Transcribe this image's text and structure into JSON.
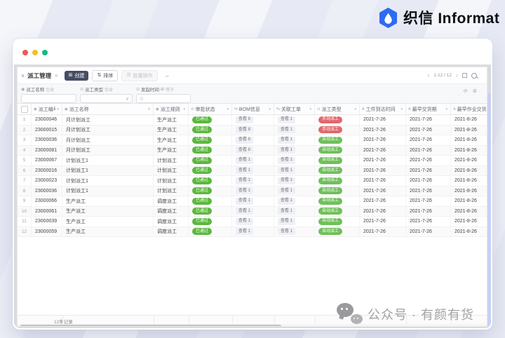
{
  "brand": {
    "name_cn": "织信",
    "name_en": "Informat"
  },
  "watermark": {
    "text": "公众号 · 有颜有货"
  },
  "colors": {
    "brand_blue": "#2e6bf2",
    "status_green": "#5cb83e",
    "type_green": "#6fc05a",
    "type_red": "#e0686d",
    "traffic_red": "#f5564e",
    "traffic_yellow": "#f7bd2c",
    "traffic_green": "#16b981"
  },
  "toolbar": {
    "collapse_glyph": "∨",
    "title": "派工管理",
    "share_glyph": "«",
    "create_label": "创建",
    "create_icon_glyph": "⊞",
    "sort_label": "排序",
    "sort_icon_glyph": "⇅",
    "batch_label": "批量操作",
    "batch_icon_glyph": "☰",
    "more_glyph": "–",
    "prev_glyph": "‹",
    "pagination": "1-12 / 12",
    "next_glyph": "›"
  },
  "filters": [
    {
      "glyph": "◉",
      "label": "派工名称",
      "op": "包含"
    },
    {
      "glyph": "⊙",
      "label": "派工类型",
      "op": "包含"
    },
    {
      "glyph": "⊙",
      "label": "发起时间",
      "extra_glyph": "⊞",
      "op": "等于"
    }
  ],
  "filterbar_icons": {
    "refresh_glyph": "⟳",
    "settings_glyph": "⚙"
  },
  "table": {
    "columns": [
      {
        "key": "code",
        "label": "派工编号",
        "icon_glyph": "◉",
        "icon_name": "text-field-icon"
      },
      {
        "key": "name",
        "label": "派工名称",
        "icon_glyph": "◉",
        "icon_name": "text-field-icon"
      },
      {
        "key": "rule",
        "label": "派工规则",
        "icon_glyph": "◉",
        "icon_name": "text-field-icon"
      },
      {
        "key": "status",
        "label": "审批状态",
        "icon_glyph": "⊙",
        "icon_name": "select-field-icon"
      },
      {
        "key": "bom",
        "label": "BOM信息",
        "icon_glyph": "%",
        "icon_name": "link-field-icon"
      },
      {
        "key": "order",
        "label": "关联工单",
        "icon_glyph": "%",
        "icon_name": "link-field-icon"
      },
      {
        "key": "type",
        "label": "派工类型",
        "icon_glyph": "⊙",
        "icon_name": "select-field-icon"
      },
      {
        "key": "arrive",
        "label": "工件到达时间",
        "icon_glyph": "A",
        "icon_name": "date-field-icon"
      },
      {
        "key": "due",
        "label": "最早交货期",
        "icon_glyph": "A",
        "icon_name": "date-field-icon"
      },
      {
        "key": "job_due",
        "label": "最早作业交货期",
        "icon_glyph": "A",
        "icon_name": "date-field-icon"
      }
    ],
    "rows": [
      {
        "num": 1,
        "code": "23000046",
        "name": "月计划派工",
        "rule": "生产派工",
        "status": "已通过",
        "bom": "查看 8",
        "order": "查看 1",
        "type": "手动派工",
        "type_style": "red",
        "arrive": "2021-7-26",
        "due": "2021-7-26",
        "job_due": "2021-8-26"
      },
      {
        "num": 2,
        "code": "23000015",
        "name": "月计划派工",
        "rule": "生产派工",
        "status": "已通过",
        "bom": "查看 8",
        "order": "查看 1",
        "type": "手动派工",
        "type_style": "red",
        "arrive": "2021-7-26",
        "due": "2021-7-26",
        "job_due": "2021-8-26"
      },
      {
        "num": 3,
        "code": "23000036",
        "name": "月计划派工",
        "rule": "生产派工",
        "status": "已通过",
        "bom": "查看 8",
        "order": "查看 1",
        "type": "自动派工",
        "type_style": "green",
        "arrive": "2021-7-26",
        "due": "2021-7-26",
        "job_due": "2021-8-26"
      },
      {
        "num": 4,
        "code": "23000081",
        "name": "月计划派工",
        "rule": "生产派工",
        "status": "已通过",
        "bom": "查看 8",
        "order": "查看 1",
        "type": "自动派工",
        "type_style": "green",
        "arrive": "2021-7-26",
        "due": "2021-7-26",
        "job_due": "2021-8-26"
      },
      {
        "num": 5,
        "code": "23000067",
        "name": "计划派工1",
        "rule": "计划派工",
        "status": "已通过",
        "bom": "查看 1",
        "order": "查看 1",
        "type": "自动派工",
        "type_style": "green",
        "arrive": "2021-7-26",
        "due": "2021-7-26",
        "job_due": "2021-8-26"
      },
      {
        "num": 6,
        "code": "23000016",
        "name": "计划派工1",
        "rule": "计划派工",
        "status": "已通过",
        "bom": "查看 1",
        "order": "查看 1",
        "type": "自动派工",
        "type_style": "green",
        "arrive": "2021-7-26",
        "due": "2021-7-26",
        "job_due": "2021-8-26"
      },
      {
        "num": 7,
        "code": "23000023",
        "name": "计划派工1",
        "rule": "计划派工",
        "status": "已通过",
        "bom": "查看 1",
        "order": "查看 1",
        "type": "自动派工",
        "type_style": "green",
        "arrive": "2021-7-26",
        "due": "2021-7-26",
        "job_due": "2021-8-26"
      },
      {
        "num": 8,
        "code": "23000036",
        "name": "计划派工1",
        "rule": "计划派工",
        "status": "已通过",
        "bom": "查看 1",
        "order": "查看 1",
        "type": "自动派工",
        "type_style": "green",
        "arrive": "2021-7-26",
        "due": "2021-7-26",
        "job_due": "2021-8-26"
      },
      {
        "num": 9,
        "code": "23000066",
        "name": "生产派工",
        "rule": "调度派工",
        "status": "已通过",
        "bom": "查看 1",
        "order": "查看 1",
        "type": "自动派工",
        "type_style": "green",
        "arrive": "2021-7-26",
        "due": "2021-7-26",
        "job_due": "2021-8-26"
      },
      {
        "num": 10,
        "code": "23000061",
        "name": "生产派工",
        "rule": "调度派工",
        "status": "已通过",
        "bom": "查看 1",
        "order": "查看 1",
        "type": "自动派工",
        "type_style": "green",
        "arrive": "2021-7-26",
        "due": "2021-7-26",
        "job_due": "2021-8-26"
      },
      {
        "num": 11,
        "code": "23000039",
        "name": "生产派工",
        "rule": "调度派工",
        "status": "已通过",
        "bom": "查看 1",
        "order": "查看 1",
        "type": "自动派工",
        "type_style": "green",
        "arrive": "2021-7-26",
        "due": "2021-7-26",
        "job_due": "2021-8-26"
      },
      {
        "num": 12,
        "code": "23000059",
        "name": "生产派工",
        "rule": "调度派工",
        "status": "已通过",
        "bom": "查看 1",
        "order": "查看 1",
        "type": "自动派工",
        "type_style": "green",
        "arrive": "2021-7-26",
        "due": "2021-7-26",
        "job_due": "2021-8-26"
      }
    ],
    "footer": {
      "record_count": "12条记录"
    }
  }
}
